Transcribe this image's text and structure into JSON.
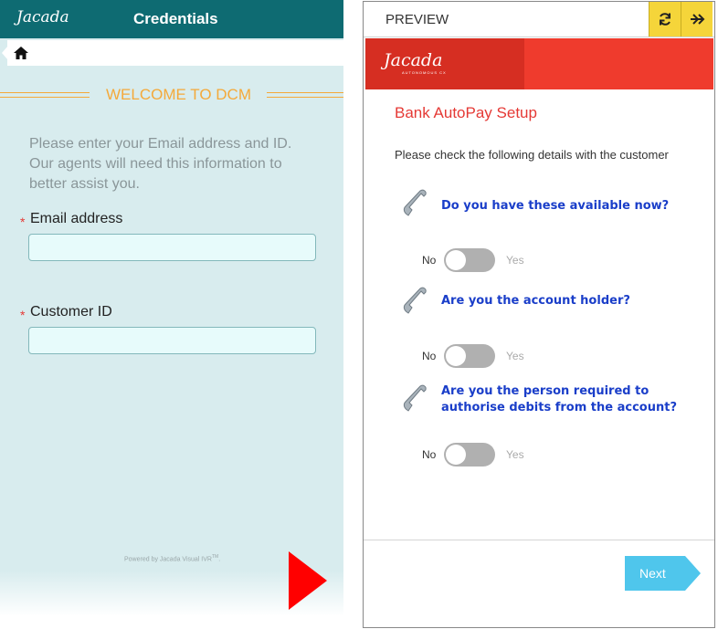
{
  "left_panel": {
    "logo": "Jacada",
    "title": "Credentials",
    "home_icon": "home-icon",
    "welcome": "WELCOME TO DCM",
    "intro_lines": [
      "Please enter your Email address and ID.",
      "Our agents will need this information to",
      "better assist you."
    ],
    "required_mark": "*",
    "email_label": "Email address",
    "email_value": "",
    "customer_id_label": "Customer ID",
    "customer_id_value": "",
    "powered_by": "Powered by Jacada Visual IVR",
    "powered_by_tm": "TM",
    "next_icon": "next-triangle-icon"
  },
  "preview": {
    "label": "PREVIEW",
    "refresh_icon": "refresh-icon",
    "forward_icon": "forward-arrow-icon",
    "brand_logo": "Jacada",
    "brand_sub": "AUTONOMOUS CX",
    "setup_title": "Bank AutoPay Setup",
    "check_text": "Please check the following details with the customer",
    "questions": [
      {
        "lines": [
          "Do you have these available now?"
        ],
        "icon": "phone-icon",
        "no": "No",
        "yes": "Yes",
        "state": "off"
      },
      {
        "lines": [
          "Are you the account holder?"
        ],
        "icon": "phone-icon",
        "no": "No",
        "yes": "Yes",
        "state": "off"
      },
      {
        "lines": [
          "Are you the person required to",
          "authorise debits from the account?"
        ],
        "icon": "phone-icon",
        "no": "No",
        "yes": "Yes",
        "state": "off"
      }
    ],
    "next_label": "Next"
  },
  "colors": {
    "left_header": "#0e6b72",
    "left_bg": "#d8ecee",
    "accent_orange": "#f4a93a",
    "brand_red": "#ef3b2d",
    "question_blue": "#1a3ec9",
    "next_blue": "#4fc6ec",
    "toolbar_yellow": "#f5d53a"
  }
}
